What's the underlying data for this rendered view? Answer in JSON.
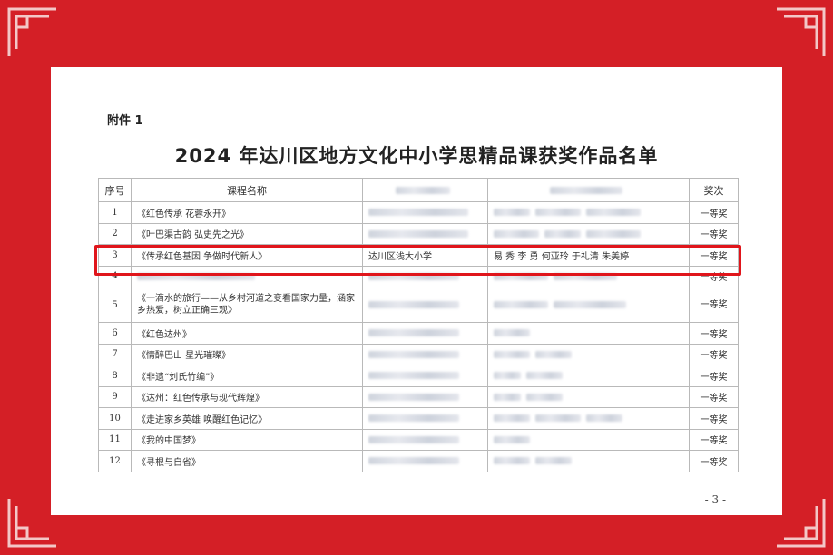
{
  "document": {
    "attachment_label": "附件 1",
    "title": "2024 年达川区地方文化中小学思精品课获奖作品名单",
    "page_number": "- 3 -"
  },
  "table": {
    "headers": [
      "序号",
      "课程名称",
      "",
      "",
      "奖次"
    ],
    "rows": [
      {
        "num": "1",
        "course": "《红色传承 花蓉永开》",
        "school": "",
        "authors": "",
        "prize": "一等奖"
      },
      {
        "num": "2",
        "course": "《叶巴渠古韵 弘史先之光》",
        "school": "",
        "authors": "",
        "prize": "一等奖"
      },
      {
        "num": "3",
        "course": "《传承红色基因 争做时代新人》",
        "school": "达川区浅大小学",
        "authors": "易 秀 李 勇 何亚玲 于礼清 朱美婷",
        "prize": "一等奖"
      },
      {
        "num": "4",
        "course": "",
        "school": "",
        "authors": "",
        "prize": "一等奖"
      },
      {
        "num": "5",
        "course": "《一滴水的旅行——从乡村河道之变看国家力量，涵家乡热爱，树立正确三观》",
        "school": "",
        "authors": "",
        "prize": "一等奖"
      },
      {
        "num": "6",
        "course": "《红色达州》",
        "school": "",
        "authors": "",
        "prize": "一等奖"
      },
      {
        "num": "7",
        "course": "《情醉巴山 星光璀璨》",
        "school": "",
        "authors": "",
        "prize": "一等奖"
      },
      {
        "num": "8",
        "course": "《非遗“刘氏竹编”》",
        "school": "",
        "authors": "",
        "prize": "一等奖"
      },
      {
        "num": "9",
        "course": "《达州：红色传承与现代辉煌》",
        "school": "",
        "authors": "",
        "prize": "一等奖"
      },
      {
        "num": "10",
        "course": "《走进家乡英雄 唤醒红色记忆》",
        "school": "",
        "authors": "",
        "prize": "一等奖"
      },
      {
        "num": "11",
        "course": "《我的中国梦》",
        "school": "",
        "authors": "",
        "prize": "一等奖"
      },
      {
        "num": "12",
        "course": "《寻根与自省》",
        "school": "",
        "authors": "",
        "prize": "一等奖"
      }
    ]
  },
  "colors": {
    "frame": "#d41f26",
    "highlight": "#e0151b"
  }
}
